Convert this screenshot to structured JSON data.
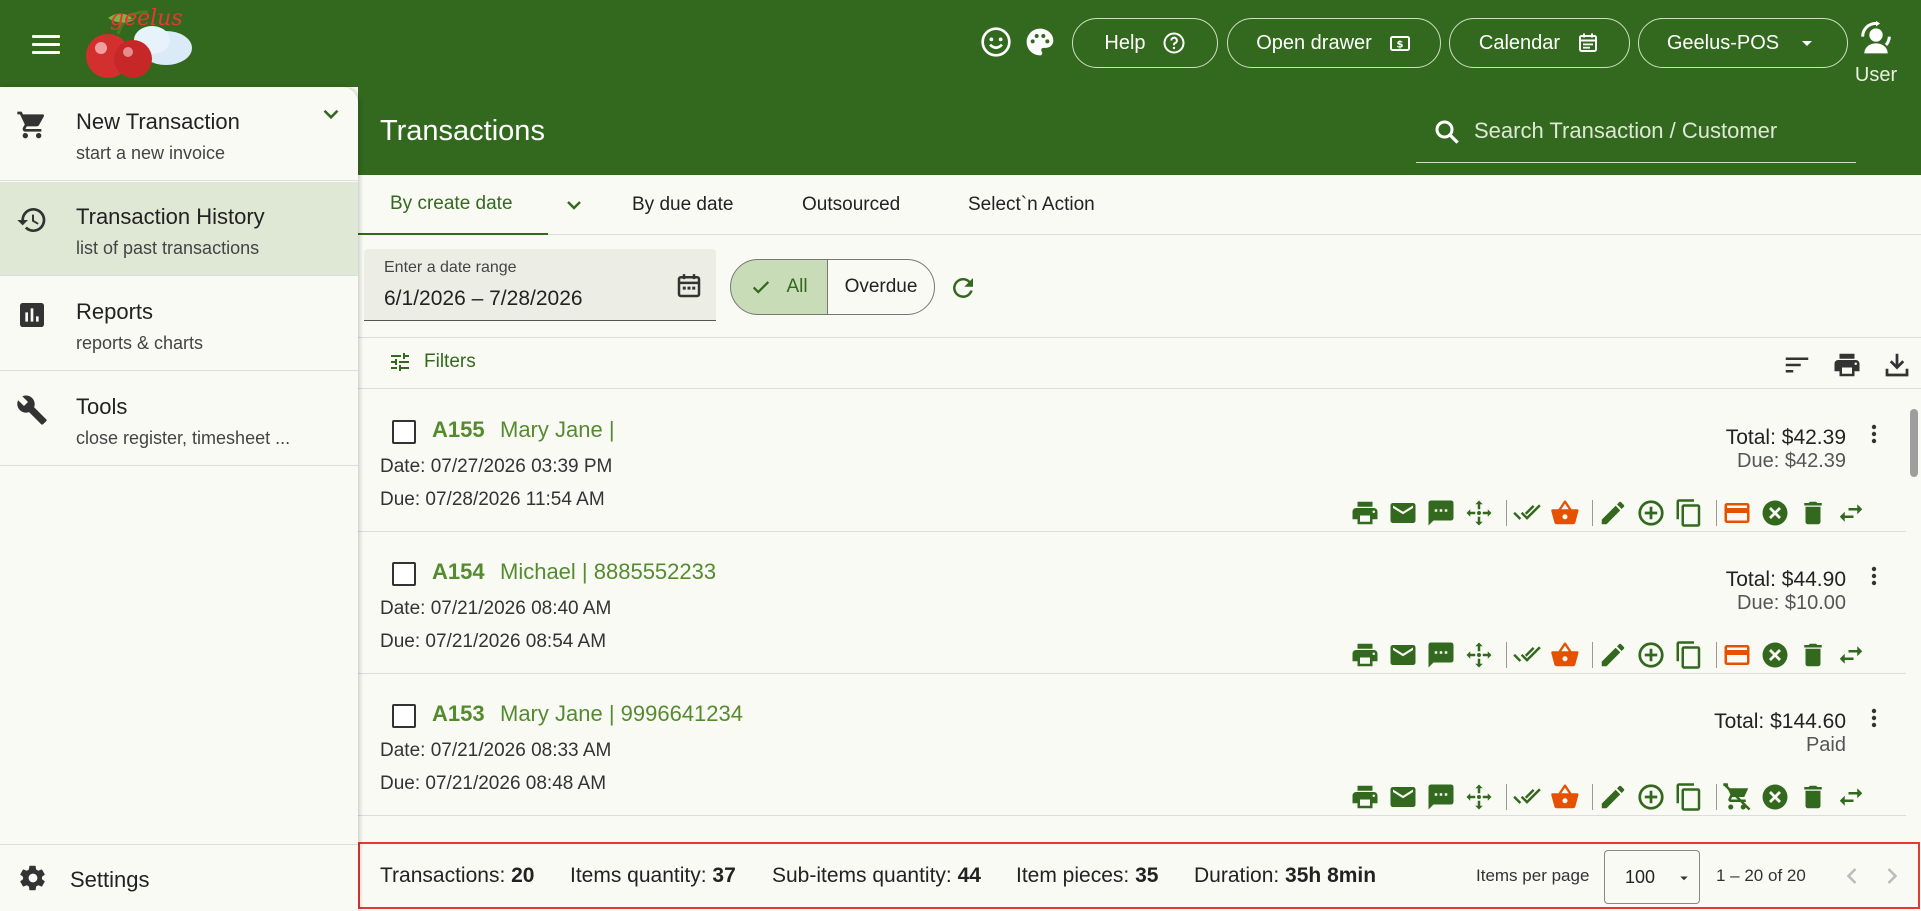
{
  "colors": {
    "primary": "#33691e",
    "accent_text": "#558b2f",
    "orange": "#e65100",
    "highlight_border": "#e53935",
    "active_nav": "#dfe8d5"
  },
  "topbar": {
    "help_label": "Help",
    "drawer_label": "Open drawer",
    "calendar_label": "Calendar",
    "store_label": "Geelus-POS",
    "user_label": "User",
    "logo_text": "geelus",
    "icons": [
      "menu-icon",
      "smiley-icon",
      "palette-icon",
      "help-circle-icon",
      "cash-drawer-icon",
      "calendar-icon",
      "dropdown-arrow-icon",
      "user-sync-icon"
    ]
  },
  "sidebar": {
    "items": [
      {
        "title": "New Transaction",
        "subtitle": "start a new invoice",
        "icon": "cart-icon"
      },
      {
        "title": "Transaction History",
        "subtitle": "list of past transactions",
        "icon": "history-icon",
        "active": true
      },
      {
        "title": "Reports",
        "subtitle": "reports & charts",
        "icon": "chart-icon"
      },
      {
        "title": "Tools",
        "subtitle": "close register, timesheet ...",
        "icon": "wrench-icon"
      }
    ],
    "settings_label": "Settings"
  },
  "main": {
    "title": "Transactions",
    "search_placeholder": "Search Transaction / Customer",
    "tabs": [
      {
        "label": "By create date",
        "active": true
      },
      {
        "label": "By due date"
      },
      {
        "label": "Outsourced"
      },
      {
        "label": "Select`n Action"
      }
    ],
    "date_range": {
      "label": "Enter a date range",
      "start": "6/1/2026",
      "separator": "–",
      "end": "7/28/2026"
    },
    "toggle_all": "All",
    "toggle_overdue": "Overdue",
    "filters_label": "Filters"
  },
  "transactions": [
    {
      "id": "A155",
      "customer": "Mary Jane |",
      "date": "Date: 07/27/2026 03:39 PM",
      "due": "Due: 07/28/2026 11:54 AM",
      "total": "Total: $42.39",
      "due_amount": "Due: $42.39"
    },
    {
      "id": "A154",
      "customer": "Michael | 8885552233",
      "date": "Date: 07/21/2026 08:40 AM",
      "due": "Due: 07/21/2026 08:54 AM",
      "total": "Total: $44.90",
      "due_amount": "Due: $10.00"
    },
    {
      "id": "A153",
      "customer": "Mary Jane | 9996641234",
      "date": "Date: 07/21/2026 08:33 AM",
      "due": "Due: 07/21/2026 08:48 AM",
      "total": "Total: $144.60",
      "due_amount": "Paid"
    }
  ],
  "footer": {
    "transactions_label": "Transactions: ",
    "transactions_value": "20",
    "items_label": "Items quantity: ",
    "items_value": "37",
    "subitems_label": "Sub-items quantity: ",
    "subitems_value": "44",
    "pieces_label": "Item pieces: ",
    "pieces_value": "35",
    "duration_label": "Duration: ",
    "duration_value": "35h 8min",
    "items_per_page_label": "Items per page",
    "items_per_page_value": "100",
    "range_text": "1 – 20 of 20"
  }
}
